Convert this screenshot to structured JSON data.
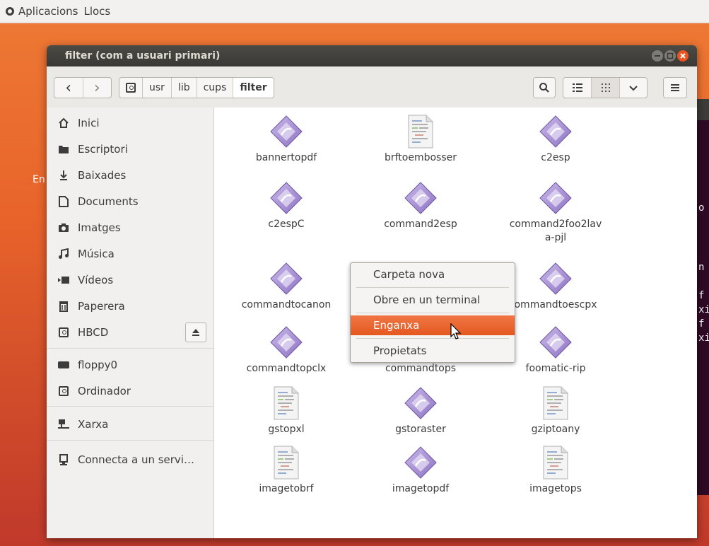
{
  "top_panel": {
    "apps": "Aplicacions",
    "places": "Llocs"
  },
  "desktop": {
    "peek_text": "En"
  },
  "terminal_peek": {
    "lines": [
      "o",
      "n",
      "f",
      "xi",
      "f",
      "xi"
    ]
  },
  "window": {
    "title": "filter (com a usuari primari)",
    "buttons": {
      "minimize": "‒",
      "maximize": "□",
      "close": "✕"
    }
  },
  "toolbar": {
    "back": "‹",
    "forward": "›",
    "path": [
      "usr",
      "lib",
      "cups",
      "filter"
    ],
    "search_icon": "⌕",
    "list_view_icon": "☰",
    "grid_view_icon": "⠿",
    "view_options_icon": "⌄",
    "menu_icon": "≡"
  },
  "sidebar": {
    "items": [
      {
        "label": "Inici",
        "icon": "home-icon",
        "glyph": "⌂"
      },
      {
        "label": "Escriptori",
        "icon": "desktop-folder-icon",
        "glyph": "▬"
      },
      {
        "label": "Baixades",
        "icon": "download-icon",
        "glyph": "⇣"
      },
      {
        "label": "Documents",
        "icon": "document-icon",
        "glyph": "▢"
      },
      {
        "label": "Imatges",
        "icon": "camera-icon",
        "glyph": "◙"
      },
      {
        "label": "Música",
        "icon": "music-icon",
        "glyph": "♫"
      },
      {
        "label": "Vídeos",
        "icon": "video-icon",
        "glyph": "▶"
      },
      {
        "label": "Paperera",
        "icon": "trash-icon",
        "glyph": "🗑"
      },
      {
        "label": "HBCD",
        "icon": "drive-icon",
        "glyph": ""
      },
      {
        "label": "floppy0",
        "icon": "floppy-icon",
        "glyph": "▬"
      },
      {
        "label": "Ordinador",
        "icon": "computer-icon",
        "glyph": ""
      },
      {
        "label": "Xarxa",
        "icon": "network-icon",
        "glyph": "▆"
      },
      {
        "label": "Connecta a un servi…",
        "icon": "server-icon",
        "glyph": "▣"
      }
    ],
    "eject": "⏏"
  },
  "files": [
    {
      "name": "bannertopdf",
      "type": "exe"
    },
    {
      "name": "brftoembosser",
      "type": "doc"
    },
    {
      "name": "c2esp",
      "type": "exe"
    },
    {
      "name": "c2espC",
      "type": "exe"
    },
    {
      "name": "command2esp",
      "type": "exe"
    },
    {
      "name": "command2foo2lav",
      "name2": "a-pjl",
      "type": "exe"
    },
    {
      "name": "commandtocanon",
      "type": "exe"
    },
    {
      "name": "",
      "type": "exe"
    },
    {
      "name": "ommandtoescpx",
      "type": "exe"
    },
    {
      "name": "commandtopclx",
      "type": "exe"
    },
    {
      "name": "commandtops",
      "type": "doc"
    },
    {
      "name": "foomatic-rip",
      "type": "exe"
    },
    {
      "name": "gstopxl",
      "type": "doc"
    },
    {
      "name": "gstoraster",
      "type": "exe"
    },
    {
      "name": "gziptoany",
      "type": "doc"
    },
    {
      "name": "imagetobrf",
      "type": "doc"
    },
    {
      "name": "imagetopdf",
      "type": "exe"
    },
    {
      "name": "imagetops",
      "type": "doc"
    }
  ],
  "context_menu": {
    "items": [
      "Carpeta nova",
      "Obre en un terminal",
      "Enganxa",
      "Propietats"
    ],
    "highlighted": "Enganxa"
  },
  "colors": {
    "accent": "#e95420",
    "titlebar": "#3c3b37",
    "desktop": "#e8632a"
  }
}
